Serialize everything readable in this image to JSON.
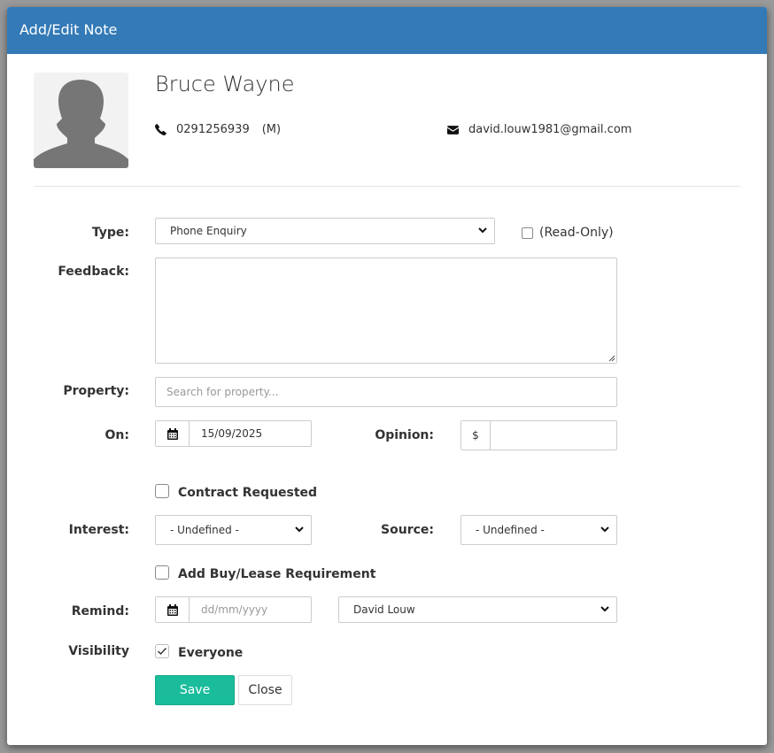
{
  "modal": {
    "title": "Add/Edit Note"
  },
  "contact": {
    "name": "Bruce Wayne",
    "phone": "0291256939",
    "phone_type": "(M)",
    "email": "david.louw1981@gmail.com"
  },
  "form": {
    "type": {
      "label": "Type:",
      "value": "Phone Enquiry"
    },
    "read_only": {
      "label": "(Read-Only)",
      "checked": false
    },
    "feedback": {
      "label": "Feedback:",
      "value": ""
    },
    "property": {
      "label": "Property:",
      "placeholder": "Search for property..."
    },
    "on": {
      "label": "On:",
      "value": "15/09/2025"
    },
    "opinion": {
      "label": "Opinion:",
      "prefix": "$",
      "value": ""
    },
    "contract_requested": {
      "label": "Contract Requested",
      "checked": false
    },
    "interest": {
      "label": "Interest:",
      "value": "- Undefined -"
    },
    "source": {
      "label": "Source:",
      "value": "- Undefined -"
    },
    "buy_lease": {
      "label": "Add Buy/Lease Requirement",
      "checked": false
    },
    "remind": {
      "label": "Remind:",
      "placeholder": "dd/mm/yyyy",
      "assignee": "David Louw"
    },
    "visibility": {
      "label": "Visibility",
      "everyone_label": "Everyone",
      "everyone_checked": true
    }
  },
  "buttons": {
    "save": "Save",
    "close": "Close"
  },
  "colors": {
    "header": "#337ab7",
    "save": "#1abc9c"
  }
}
